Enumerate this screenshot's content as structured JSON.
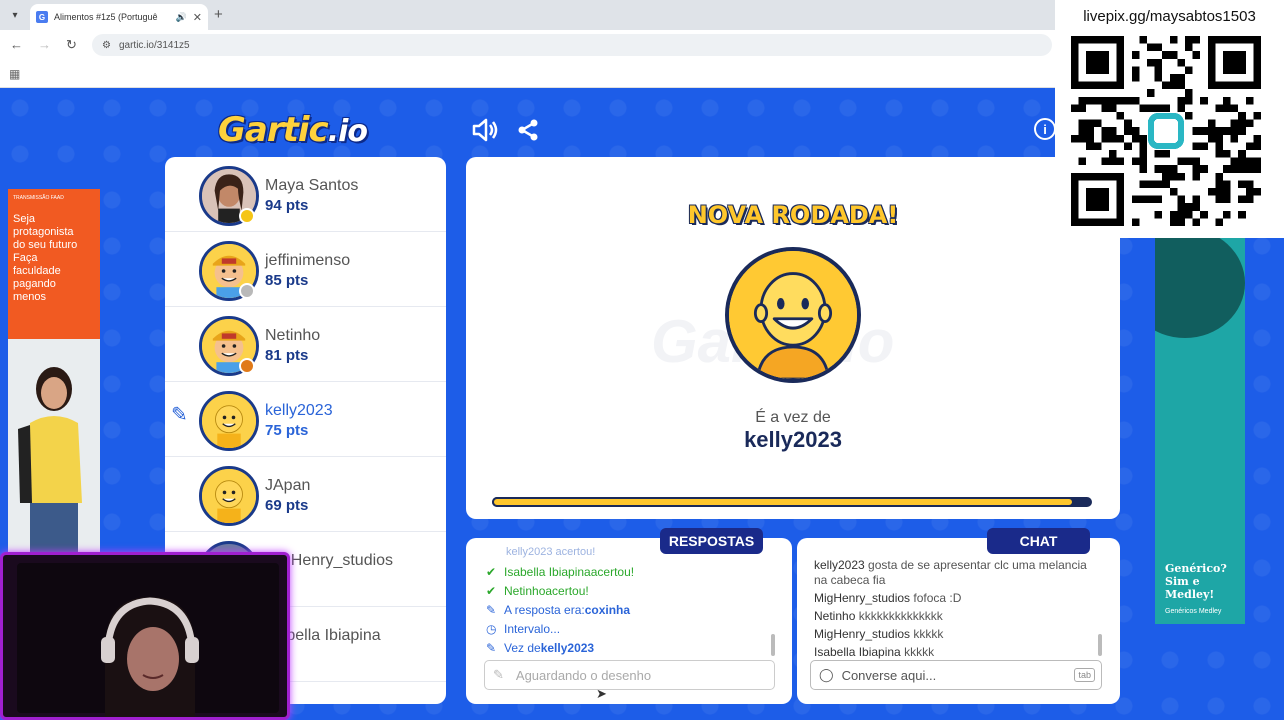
{
  "browser": {
    "tab_title": "Alimentos #1z5 (Portuguê",
    "favicon_letter": "G",
    "url": "gartic.io/3141z5"
  },
  "game": {
    "logo_text": "Gartic",
    "logo_suffix": ".io",
    "players": [
      {
        "name": "Maya Santos",
        "points": "94 pts",
        "status_color": "#f5c516"
      },
      {
        "name": "jeffinimenso",
        "points": "85 pts",
        "status_color": "#b9b9b9"
      },
      {
        "name": "Netinho",
        "points": "81 pts",
        "status_color": "#e07a19"
      },
      {
        "name": "kelly2023",
        "points": "75 pts",
        "status_color": ""
      },
      {
        "name": "JApan",
        "points": "69 pts",
        "status_color": ""
      },
      {
        "name": "MigHenry_studios",
        "points": "pts",
        "status_color": ""
      },
      {
        "name": "Isabella Ibiapina",
        "points": "pts",
        "status_color": ""
      }
    ],
    "canvas": {
      "round_title": "NOVA RODADA!",
      "watermark": "Gartic.io",
      "turn_label": "É a vez de",
      "turn_name": "kelly2023",
      "timer_fraction": 0.97
    },
    "answers": {
      "tab_label": "RESPOSTAS",
      "partial_top": "kelly2023 acertou!",
      "items": [
        {
          "type": "correct",
          "icon": "check-icon",
          "name": "Isabella Ibiapina",
          "text": " acertou!"
        },
        {
          "type": "correct",
          "icon": "check-icon",
          "name": "Netinho",
          "text": " acertou!"
        },
        {
          "type": "info",
          "icon": "pencil-icon",
          "name": "A resposta era: ",
          "text": "coxinha"
        },
        {
          "type": "info",
          "icon": "clock-icon",
          "name": "Intervalo...",
          "text": ""
        },
        {
          "type": "info",
          "icon": "pencil-icon",
          "name": "Vez de ",
          "text": "kelly2023"
        }
      ],
      "input_placeholder": "Aguardando o desenho"
    },
    "chat": {
      "tab_label": "CHAT",
      "messages": [
        {
          "user": "kelly2023",
          "text": " gosta de se apresentar clc uma melancia na cabeca fia"
        },
        {
          "user": "MigHenry_studios",
          "text": " fofoca :D"
        },
        {
          "user": "Netinho",
          "text": " kkkkkkkkkkkkkk"
        },
        {
          "user": "MigHenry_studios",
          "text": " kkkkk"
        },
        {
          "user": "Isabella Ibiapina",
          "text": " kkkkk"
        }
      ],
      "input_placeholder": "Converse aqui...",
      "tab_key": "tab"
    }
  },
  "ads": {
    "left": {
      "tag": "TRANSMISSÃO FAAD",
      "lines": [
        "Seja",
        "protagonista",
        "do seu futuro"
      ],
      "bold_lines": [
        "Faça",
        "faculdade",
        "pagando",
        "menos"
      ]
    },
    "right": {
      "lines": [
        "Genérico?",
        "Sim e",
        "Medley!"
      ],
      "small": "Genéricos Medley"
    }
  },
  "overlay": {
    "livepix": "livepix.gg/maysabtos1503"
  }
}
